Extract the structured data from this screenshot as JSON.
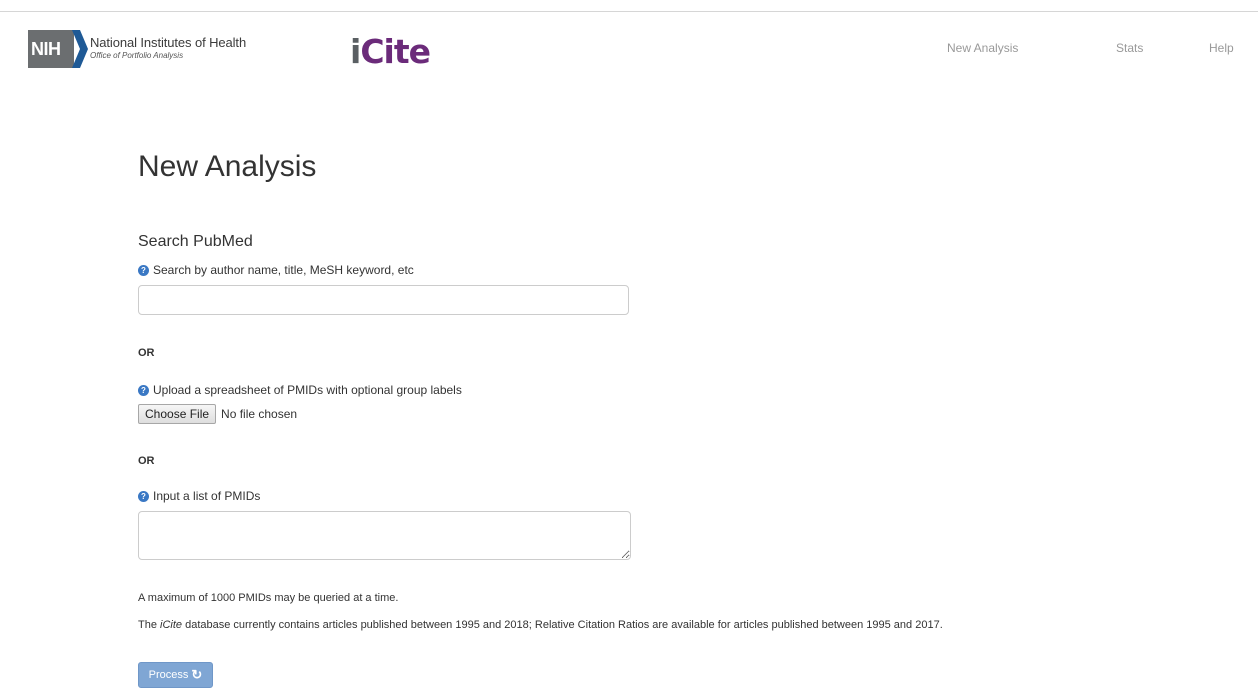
{
  "header": {
    "nih_badge": "NIH",
    "nih_title": "National Institutes of Health",
    "nih_subtitle": "Office of Portfolio Analysis",
    "app_logo_i": "i",
    "app_logo_rest": "Cite",
    "nav": [
      {
        "label": "New Analysis"
      },
      {
        "label": "Stats"
      },
      {
        "label": "Help"
      }
    ]
  },
  "main": {
    "page_title": "New Analysis",
    "search_section_title": "Search PubMed",
    "search_help": "Search by author name, title, MeSH keyword, etc",
    "search_value": "",
    "or_label": "OR",
    "upload_help": "Upload a spreadsheet of PMIDs with optional group labels",
    "choose_file_label": "Choose File",
    "file_status": "No file chosen",
    "pmid_help": "Input a list of PMIDs",
    "pmid_value": "",
    "max_note": "A maximum of 1000 PMIDs may be queried at a time.",
    "db_note_before": "The ",
    "db_note_em": "iCite",
    "db_note_after": " database currently contains articles published between 1995 and 2018; Relative Citation Ratios are available for articles published between 1995 and 2017.",
    "process_label": "Process"
  },
  "icons": {
    "help": "question-circle-icon",
    "process": "refresh-icon"
  },
  "colors": {
    "brand_purple": "#6b2b7a",
    "nih_gray": "#6b6e70",
    "nih_blue": "#1f5a96",
    "help_icon_blue": "#3a78c4",
    "process_button": "#7fa6d4",
    "nav_text": "#999999"
  }
}
